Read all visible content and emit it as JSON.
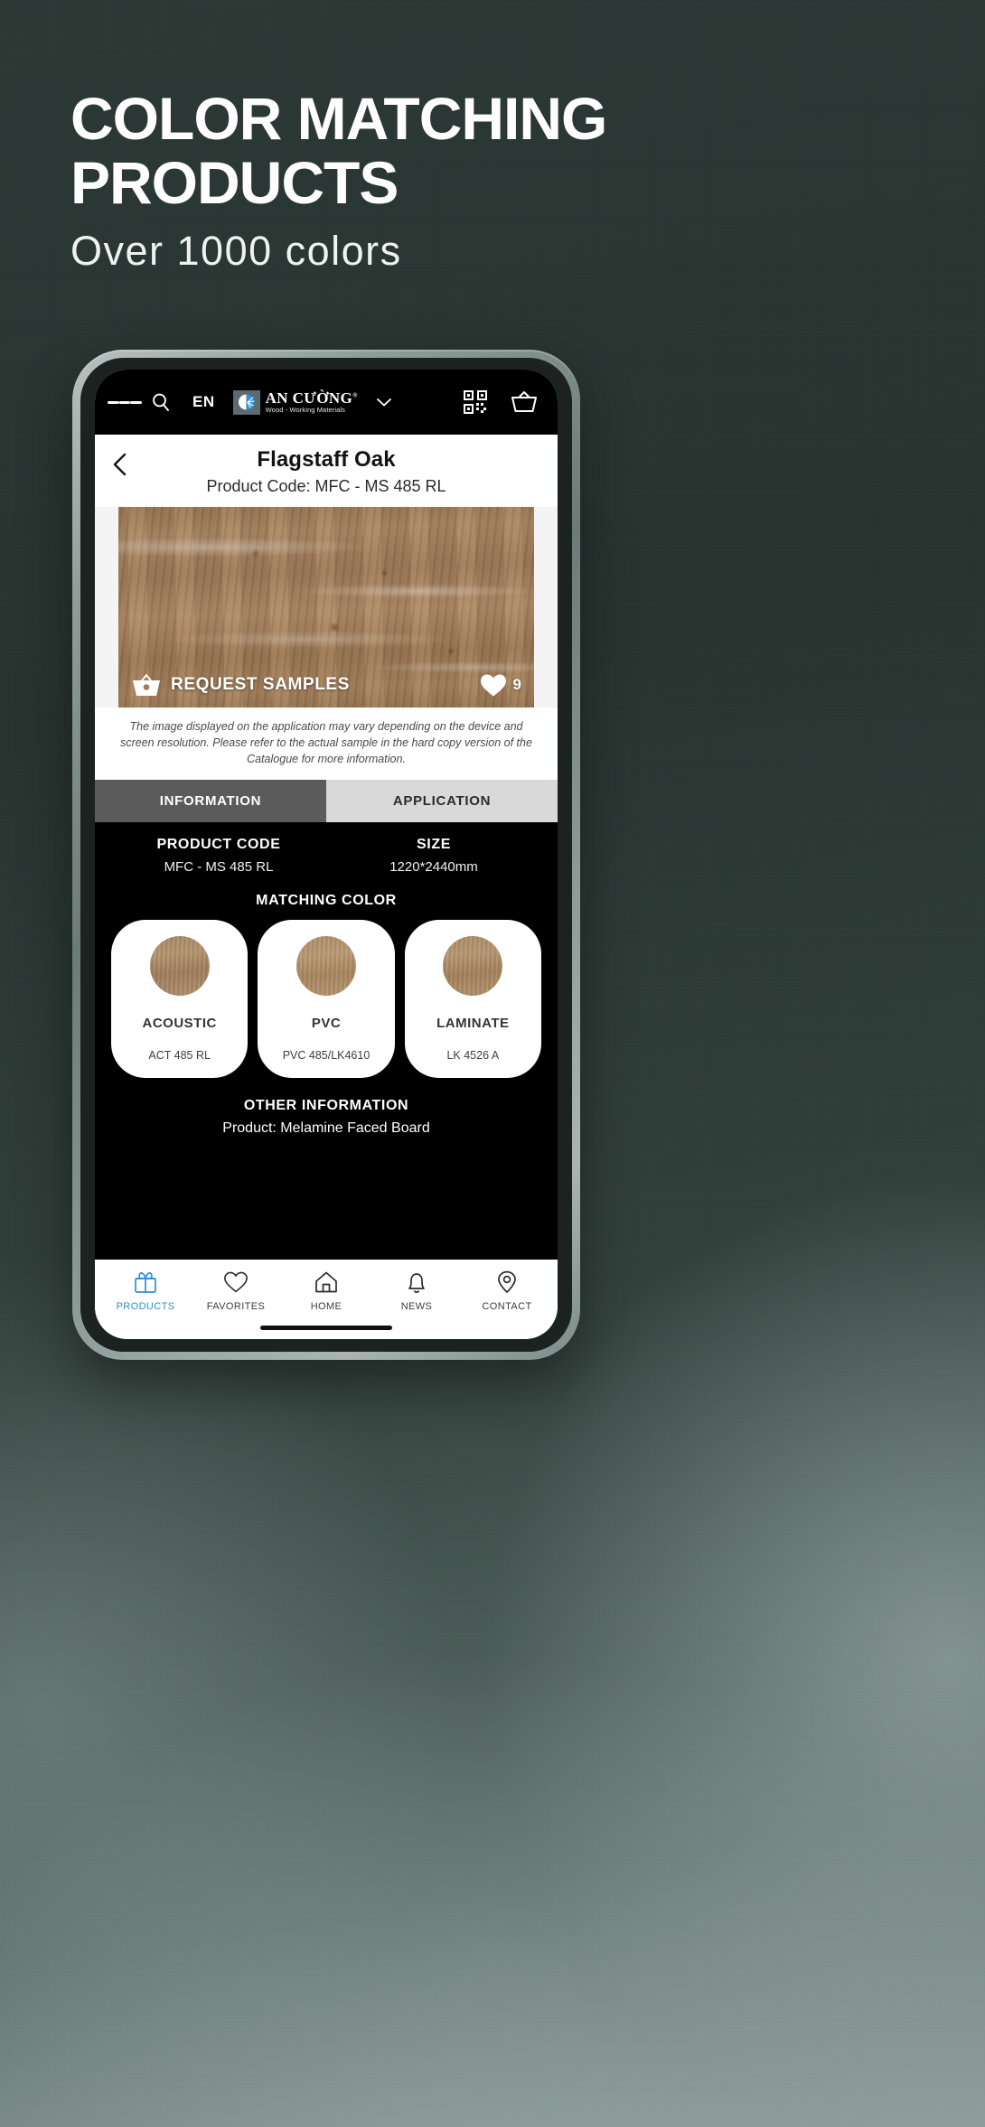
{
  "poster": {
    "headline_line1": "COLOR MATCHING",
    "headline_line2": "PRODUCTS",
    "subhead": "Over 1000 colors",
    "bg_color": "#2e3b37"
  },
  "app": {
    "header": {
      "menu_icon": "hamburger-menu-icon",
      "search_icon": "search-icon",
      "language": "EN",
      "brand_name": "AN CƯỜNG",
      "brand_registered": "®",
      "brand_tagline": "Wood - Working Materials",
      "dropdown_icon": "chevron-down-icon",
      "qr_icon": "qr-code-icon",
      "cart_icon": "shopping-basket-icon"
    },
    "title_bar": {
      "back_icon": "back-chevron-icon",
      "product_name": "Flagstaff Oak",
      "product_code_line": "Product Code:  MFC - MS 485 RL"
    },
    "hero": {
      "request_samples_label": "REQUEST SAMPLES",
      "basket_icon": "basket-icon",
      "heart_icon": "heart-filled-icon",
      "favorite_count": "9"
    },
    "disclaimer": "The image displayed on the application may vary depending on the device and screen resolution. Please refer to the actual sample in the hard copy version of the Catalogue for more information.",
    "tabs": [
      {
        "label": "INFORMATION",
        "active": true
      },
      {
        "label": "APPLICATION",
        "active": false
      }
    ],
    "information": {
      "product_code_label": "PRODUCT CODE",
      "product_code_value": "MFC - MS 485 RL",
      "size_label": "SIZE",
      "size_value": "1220*2440mm",
      "matching_color_title": "MATCHING COLOR",
      "matching_colors": [
        {
          "name": "ACOUSTIC",
          "code": "ACT 485 RL"
        },
        {
          "name": "PVC",
          "code": "PVC 485/LK4610"
        },
        {
          "name": "LAMINATE",
          "code": "LK 4526 A"
        }
      ],
      "other_information_title": "OTHER INFORMATION",
      "other_information_value": "Product: Melamine Faced Board"
    },
    "bottom_nav": [
      {
        "label": "PRODUCTS",
        "icon": "products-icon",
        "active": true
      },
      {
        "label": "FAVORITES",
        "icon": "heart-outline-icon",
        "active": false
      },
      {
        "label": "HOME",
        "icon": "home-icon",
        "active": false
      },
      {
        "label": "NEWS",
        "icon": "bell-icon",
        "active": false
      },
      {
        "label": "CONTACT",
        "icon": "map-pin-icon",
        "active": false
      }
    ],
    "accent_color": "#2d8fd5"
  }
}
